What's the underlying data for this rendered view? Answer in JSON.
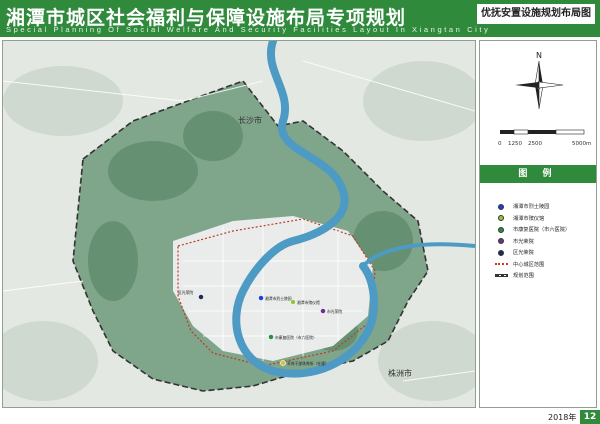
{
  "header": {
    "title": "湘潭市城区社会福利与保障设施布局专项规划",
    "subtitle": "Special Planning Of Social Welfare And Security Facilities Layout In Xiangtan City"
  },
  "sheet": {
    "title": "优抚安置设施规划布局图"
  },
  "map": {
    "place_labels": {
      "changsha": "长沙市",
      "zhuzhou": "株洲市"
    },
    "facilities": [
      {
        "label": "湘潭市烈士陵园",
        "category": "martyrs-cemetery",
        "color": "#1f3fd6"
      },
      {
        "label": "湘潭市殡仪馆",
        "category": "funeral-home",
        "color": "#8dc63f"
      },
      {
        "label": "市康复医院（市六医院）",
        "category": "rehab-hospital",
        "color": "#2a8f3a"
      },
      {
        "label": "市光荣院",
        "category": "honor-home",
        "color": "#6b2f8f"
      },
      {
        "label": "军休干部休养所（在建）",
        "category": "retirement",
        "color": "#d4c43a"
      },
      {
        "label": "区光荣院",
        "category": "district-honor-home",
        "color": "#1d2a5c"
      }
    ],
    "colors": {
      "river": "#4d9bc4",
      "hills": "#6f9a7a",
      "urban_boundary": "#c0392b",
      "plan_boundary": "#222222"
    }
  },
  "north_arrow": {
    "letter": "N"
  },
  "scale_bar": {
    "ticks": [
      "0",
      "1250",
      "2500",
      "5000m"
    ]
  },
  "legend": {
    "heading": "图 例",
    "items": [
      {
        "label": "湘潭市烈士陵园",
        "kind": "dot",
        "color": "#1f3fd6"
      },
      {
        "label": "湘潭市殡仪馆",
        "kind": "dot",
        "color": "#8dc63f"
      },
      {
        "label": "市康复医院（市六医院）",
        "kind": "dot",
        "color": "#2a8f3a"
      },
      {
        "label": "市光荣院",
        "kind": "dot",
        "color": "#6b2f8f"
      },
      {
        "label": "区光荣院",
        "kind": "dot",
        "color": "#1d2a5c"
      },
      {
        "label": "中心城区范围",
        "kind": "red-line",
        "color": "#c0392b"
      },
      {
        "label": "规划范围",
        "kind": "dark-line",
        "color": "#222222"
      }
    ]
  },
  "footer": {
    "year": "2018年",
    "page": "12"
  }
}
